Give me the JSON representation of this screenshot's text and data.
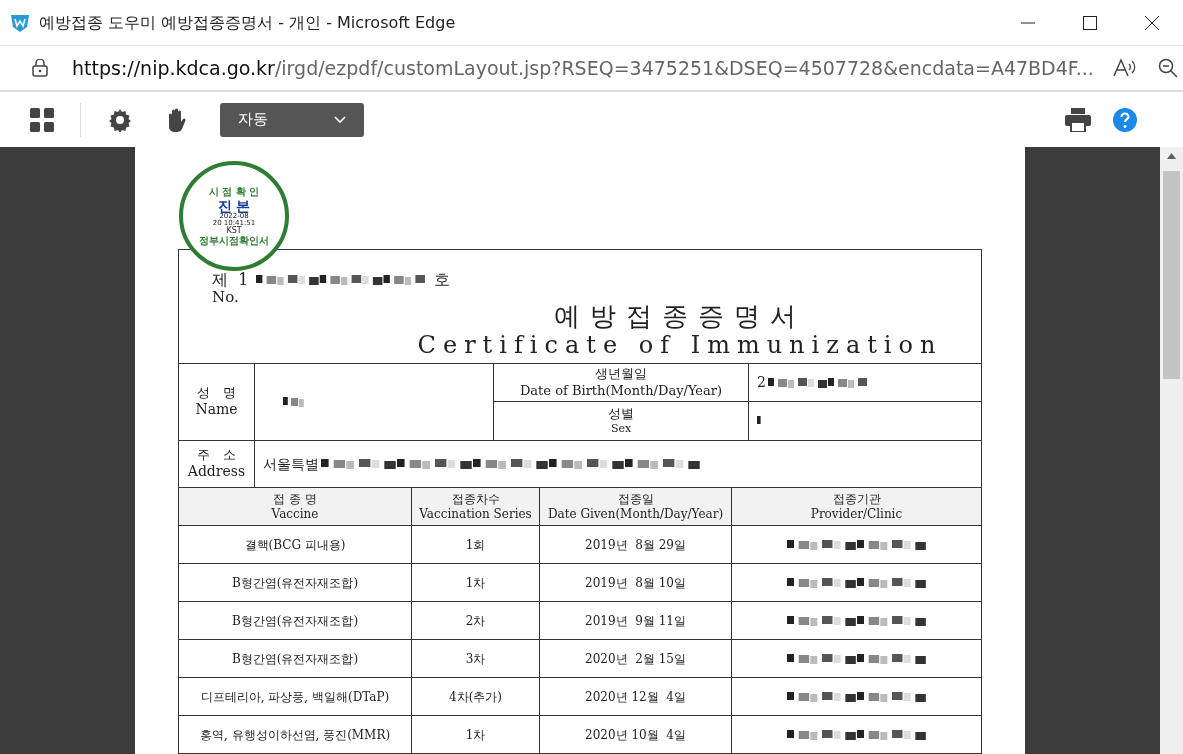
{
  "window": {
    "title": "예방접종 도우미 예방접종증명서 - 개인 - Microsoft Edge",
    "url_host": "https://nip.kdca.go.kr",
    "url_path": "/irgd/ezpdf/customLayout.jsp?RSEQ=3475251&DSEQ=4507728&encdata=A47BD4F..."
  },
  "toolbar": {
    "zoom": "자동"
  },
  "stamp": {
    "top": "시 점 확 인",
    "middle": "진 본",
    "date": "2022-08",
    "time": "20 10:41:51",
    "zone": "KST",
    "bottom": "정부시점확인서"
  },
  "document": {
    "number_prefix": "제  1",
    "number_suffix": "호",
    "number_label": "No.",
    "title_ko": "예방접종증명서",
    "title_en": "Certificate of Immunization",
    "name_label_ko": "성   명",
    "name_label_en": "Name",
    "dob_label_ko": "생년월일",
    "dob_label_en": "Date of Birth(Month/Day/Year)",
    "dob_value": "2",
    "sex_label_ko": "성별",
    "sex_label_en": "Sex",
    "address_label_ko": "주   소",
    "address_label_en": "Address",
    "address_value": "서울특별"
  },
  "table": {
    "columns": [
      {
        "ko": "접 종 명",
        "en": "Vaccine"
      },
      {
        "ko": "접종차수",
        "en": "Vaccination Series"
      },
      {
        "ko": "접종일",
        "en": "Date Given(Month/Day/Year)"
      },
      {
        "ko": "접종기관",
        "en": "Provider/Clinic"
      }
    ],
    "rows": [
      {
        "vaccine": "결핵(BCG 피내용)",
        "series": "1회",
        "date": "2019년  8월 29일"
      },
      {
        "vaccine": "B형간염(유전자재조합)",
        "series": "1차",
        "date": "2019년  8월 10일"
      },
      {
        "vaccine": "B형간염(유전자재조합)",
        "series": "2차",
        "date": "2019년  9월 11일"
      },
      {
        "vaccine": "B형간염(유전자재조합)",
        "series": "3차",
        "date": "2020년  2월 15일"
      },
      {
        "vaccine": "디프테리아, 파상풍, 백일해(DTaP)",
        "series": "4차(추가)",
        "date": "2020년 12월  4일"
      },
      {
        "vaccine": "홍역, 유행성이하선염, 풍진(MMR)",
        "series": "1차",
        "date": "2020년 10월  4일"
      }
    ]
  }
}
